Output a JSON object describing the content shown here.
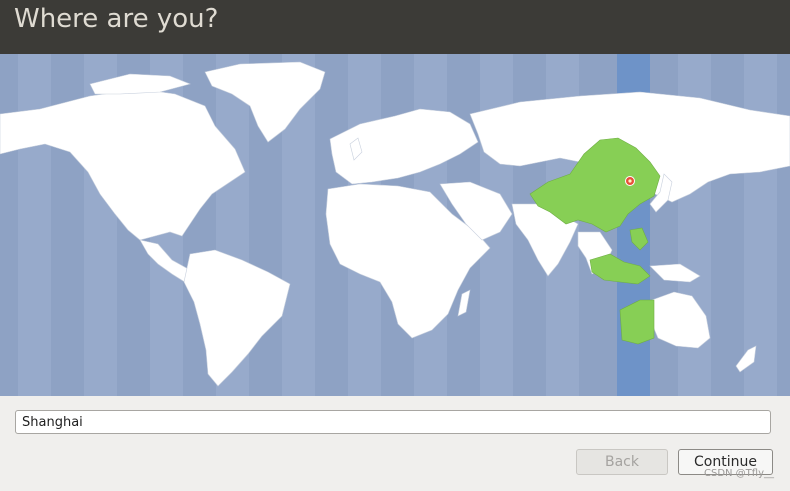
{
  "header": {
    "title": "Where are you?"
  },
  "location": {
    "value": "Shanghai"
  },
  "buttons": {
    "back_label": "Back",
    "continue_label": "Continue"
  },
  "watermark": "CSDN @Tfly__",
  "map": {
    "selected_timezone_city": "Shanghai"
  },
  "colors": {
    "header_bg": "#3c3b37",
    "ocean": "#8ea2c4",
    "land": "#ffffff",
    "selected_region": "#87cf55",
    "timezone_band": "#6e93c8",
    "marker": "#e8503a"
  }
}
